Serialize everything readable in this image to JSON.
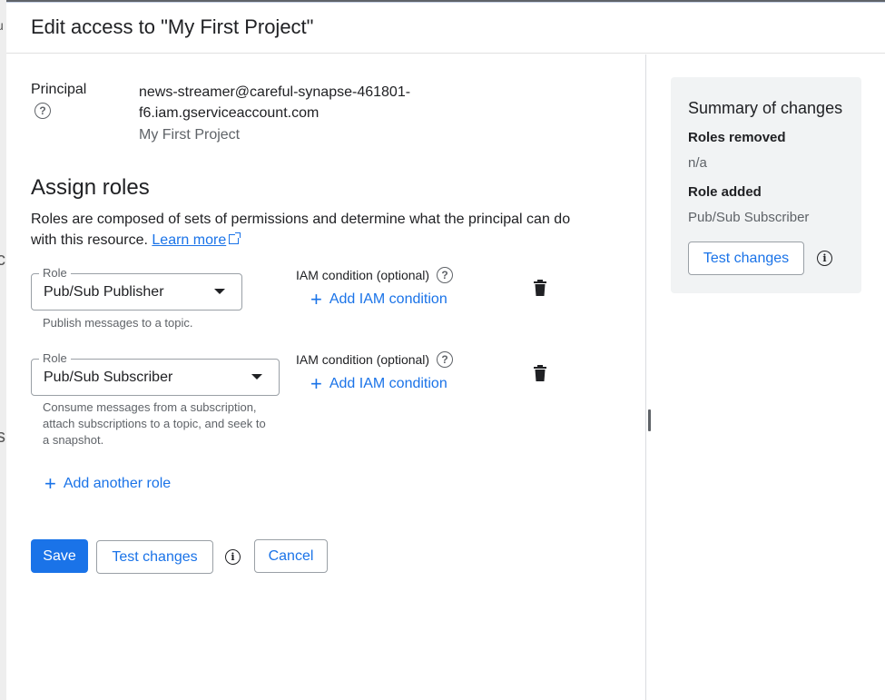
{
  "dialog": {
    "title": "Edit access to \"My First Project\""
  },
  "principal": {
    "label": "Principal",
    "email": "news-streamer@careful-synapse-461801-f6.iam.gserviceaccount.com",
    "project": "My First Project"
  },
  "assign_roles": {
    "heading": "Assign roles",
    "description": "Roles are composed of sets of permissions and determine what the principal can do with this resource.",
    "learn_more": "Learn more",
    "roles": [
      {
        "field_label": "Role",
        "value": "Pub/Sub Publisher",
        "hint": "Publish messages to a topic.",
        "iam_label": "IAM condition (optional)",
        "add_iam_label": "Add IAM condition"
      },
      {
        "field_label": "Role",
        "value": "Pub/Sub Subscriber",
        "hint": "Consume messages from a subscription, attach subscriptions to a topic, and seek to a snapshot.",
        "iam_label": "IAM condition (optional)",
        "add_iam_label": "Add IAM condition"
      }
    ],
    "add_another_role": "Add another role"
  },
  "footer": {
    "save": "Save",
    "test_changes": "Test changes",
    "cancel": "Cancel"
  },
  "summary": {
    "title": "Summary of changes",
    "roles_removed_label": "Roles removed",
    "roles_removed_value": "n/a",
    "role_added_label": "Role added",
    "role_added_value": "Pub/Sub Subscriber",
    "test_changes": "Test changes"
  },
  "colors": {
    "accent": "#1a73e8",
    "summary_bg": "#f1f3f4"
  }
}
